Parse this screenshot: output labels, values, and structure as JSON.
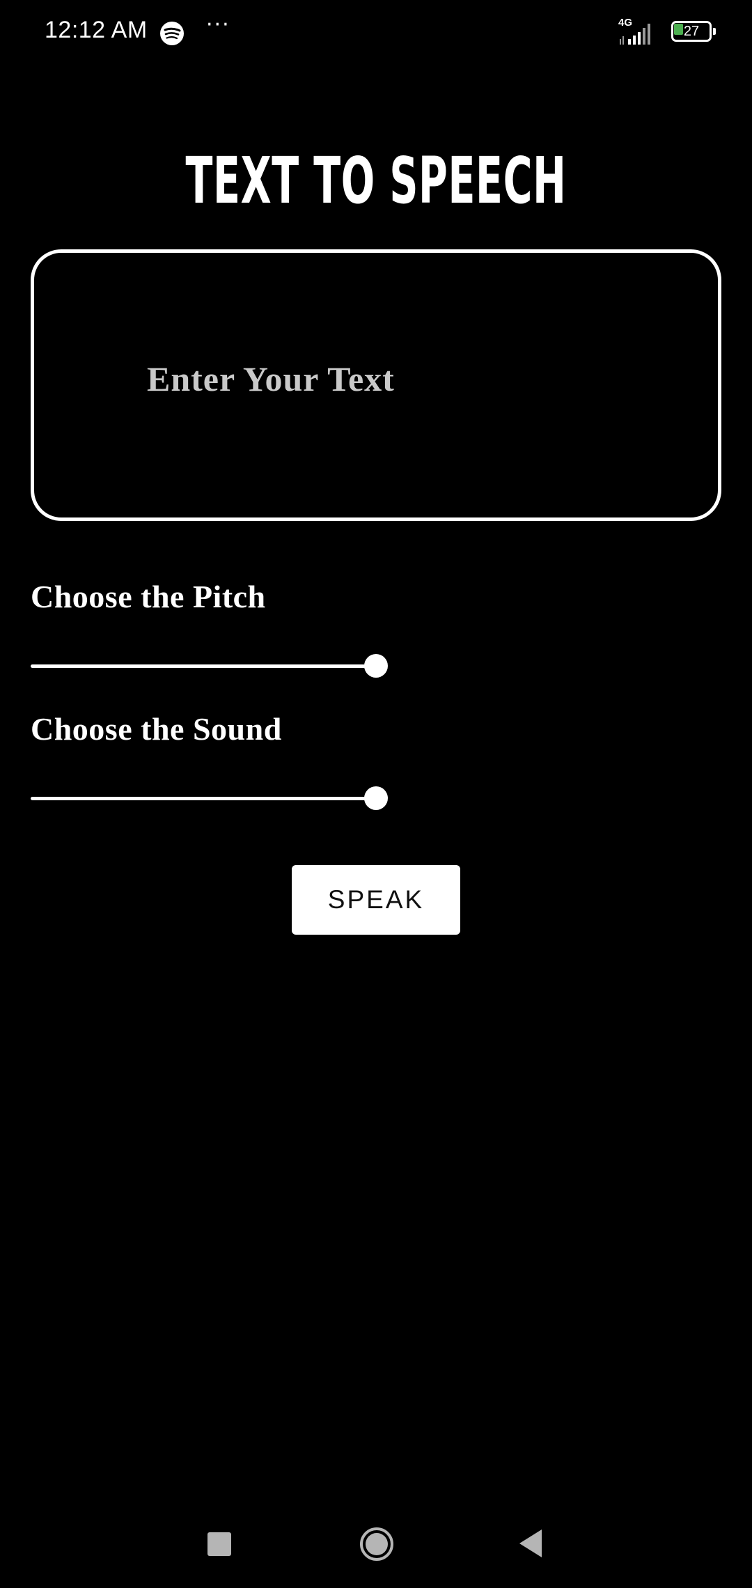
{
  "status_bar": {
    "time": "12:12 AM",
    "more_indicator": "···",
    "network_label": "4G",
    "battery_level": "27",
    "icons": {
      "app_notification": "spotify-icon",
      "signal": "signal-icon",
      "battery": "battery-icon"
    },
    "colors": {
      "battery_fill": "#4caf50"
    }
  },
  "header": {
    "title": "TEXT TO SPEECH"
  },
  "text_input": {
    "value": "",
    "placeholder": "Enter Your Text"
  },
  "pitch": {
    "label": "Choose the Pitch",
    "level": 1.0
  },
  "sound": {
    "label": "Choose the Sound",
    "level": 1.0
  },
  "speak_button": {
    "label": "SPEAK"
  },
  "nav_bar": {
    "icons": [
      "recent-apps-icon",
      "home-icon",
      "back-icon"
    ]
  },
  "colors": {
    "background": "#000000",
    "foreground": "#ffffff",
    "placeholder": "#c9c9c9"
  }
}
